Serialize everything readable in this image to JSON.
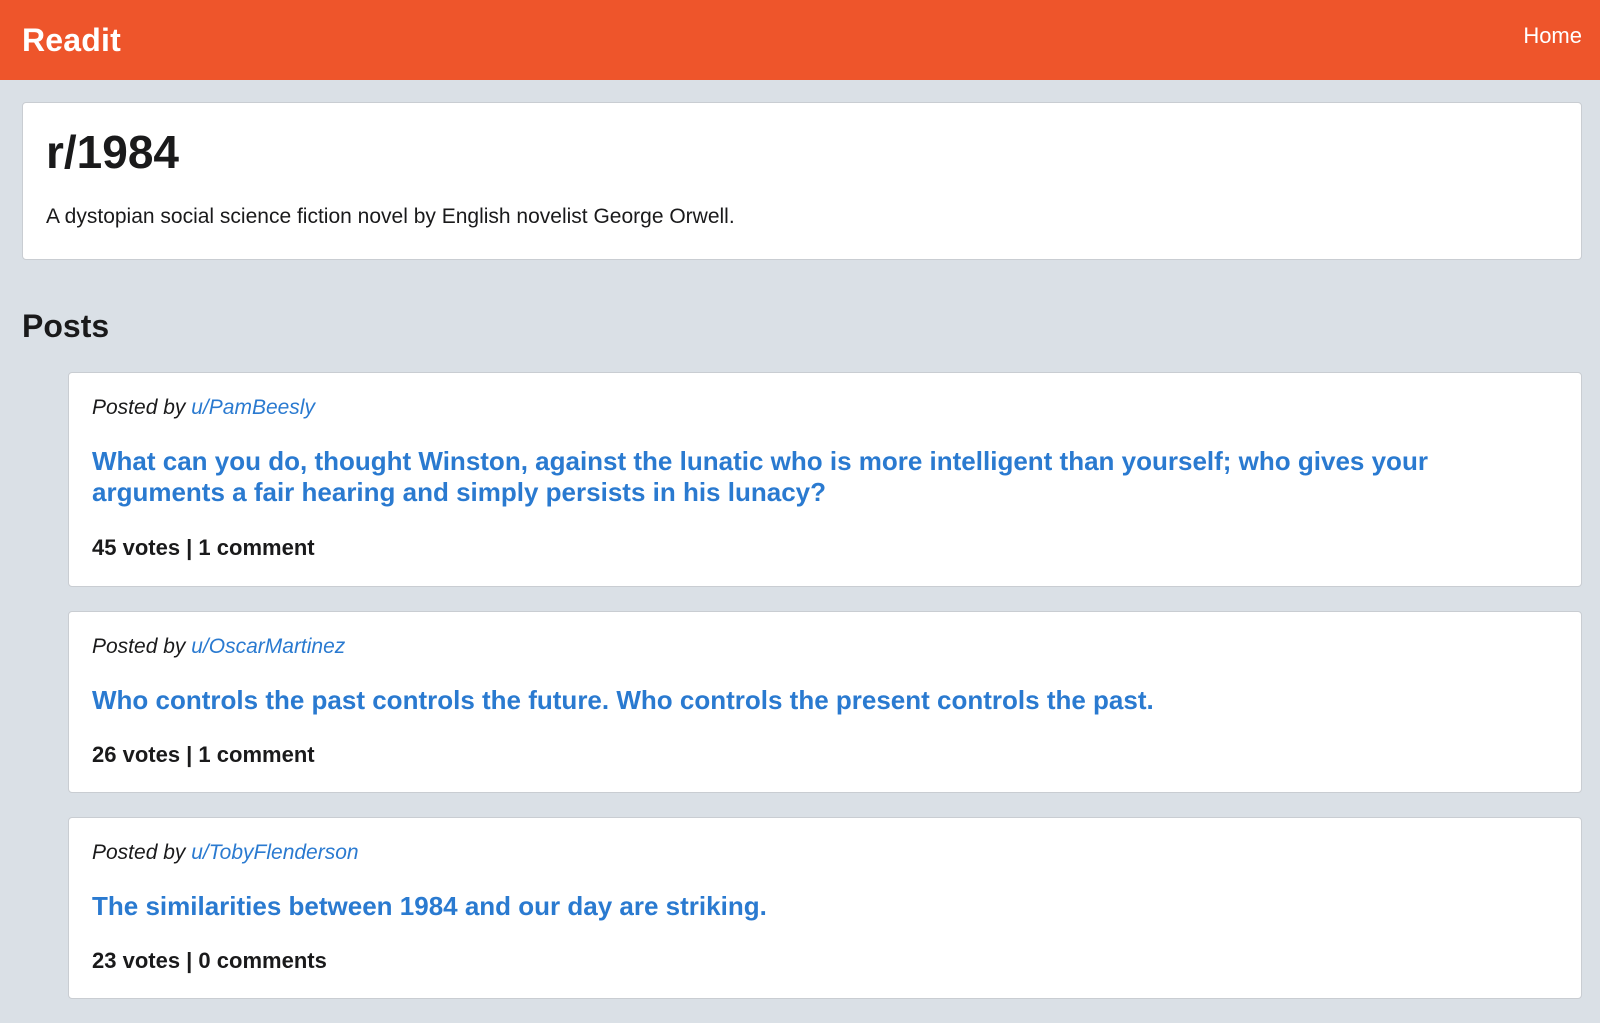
{
  "navbar": {
    "brand": "Readit",
    "home_label": "Home",
    "color": "#ee552b"
  },
  "subreddit": {
    "name": "r/1984",
    "description": "A dystopian social science fiction novel by English novelist George Orwell."
  },
  "posts_heading": "Posts",
  "posts": [
    {
      "posted_by_prefix": "Posted by",
      "author": "u/PamBeesly",
      "title": "What can you do, thought Winston, against the lunatic who is more intelligent than yourself; who gives your arguments a fair hearing and simply persists in his lunacy?",
      "stats": "45 votes | 1 comment"
    },
    {
      "posted_by_prefix": "Posted by",
      "author": "u/OscarMartinez",
      "title": "Who controls the past controls the future. Who controls the present controls the past.",
      "stats": "26 votes | 1 comment"
    },
    {
      "posted_by_prefix": "Posted by",
      "author": "u/TobyFlenderson",
      "title": "The similarities between 1984 and our day are striking.",
      "stats": "23 votes | 0 comments"
    }
  ],
  "colors": {
    "background": "#dae0e6",
    "link": "#2a7ad0",
    "text": "#1a1a1b"
  }
}
